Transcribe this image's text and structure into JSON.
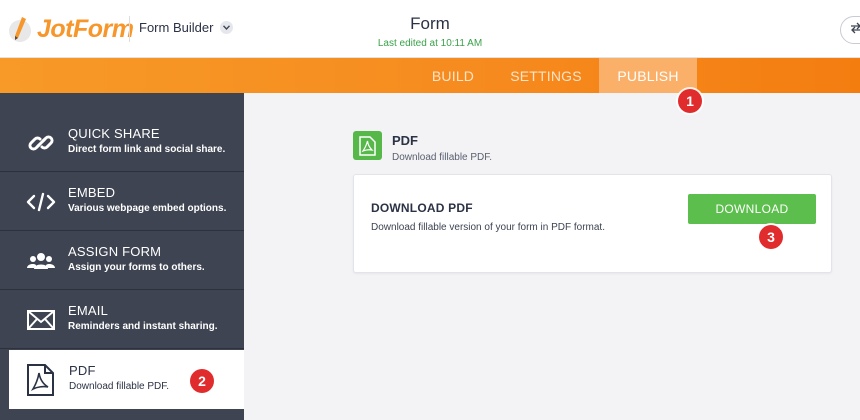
{
  "header": {
    "logo_text": "JotForm",
    "builder_label": "Form Builder",
    "form_title": "Form",
    "last_edited": "Last edited at 10:11 AM"
  },
  "nav": {
    "tabs": [
      {
        "label": "BUILD"
      },
      {
        "label": "SETTINGS"
      },
      {
        "label": "PUBLISH",
        "active": true
      }
    ]
  },
  "sidebar": {
    "items": [
      {
        "title": "QUICK SHARE",
        "desc": "Direct form link and social share.",
        "icon": "link-icon"
      },
      {
        "title": "EMBED",
        "desc": "Various webpage embed options.",
        "icon": "code-icon"
      },
      {
        "title": "ASSIGN FORM",
        "desc": "Assign your forms to others.",
        "icon": "users-icon"
      },
      {
        "title": "EMAIL",
        "desc": "Reminders and instant sharing.",
        "icon": "envelope-icon"
      },
      {
        "title": "PDF",
        "desc": "Download fillable PDF.",
        "icon": "pdf-icon",
        "active": true
      }
    ]
  },
  "main": {
    "section_title": "PDF",
    "section_desc": "Download fillable PDF.",
    "card": {
      "title": "DOWNLOAD PDF",
      "desc": "Download fillable version of your form in PDF format.",
      "button_label": "DOWNLOAD"
    }
  },
  "steps": {
    "s1": "1",
    "s2": "2",
    "s3": "3"
  },
  "colors": {
    "brand_orange": "#f68b1f",
    "sidebar_bg": "#3e4451",
    "download_green": "#5cbe4c",
    "step_red": "#e02c2c"
  }
}
